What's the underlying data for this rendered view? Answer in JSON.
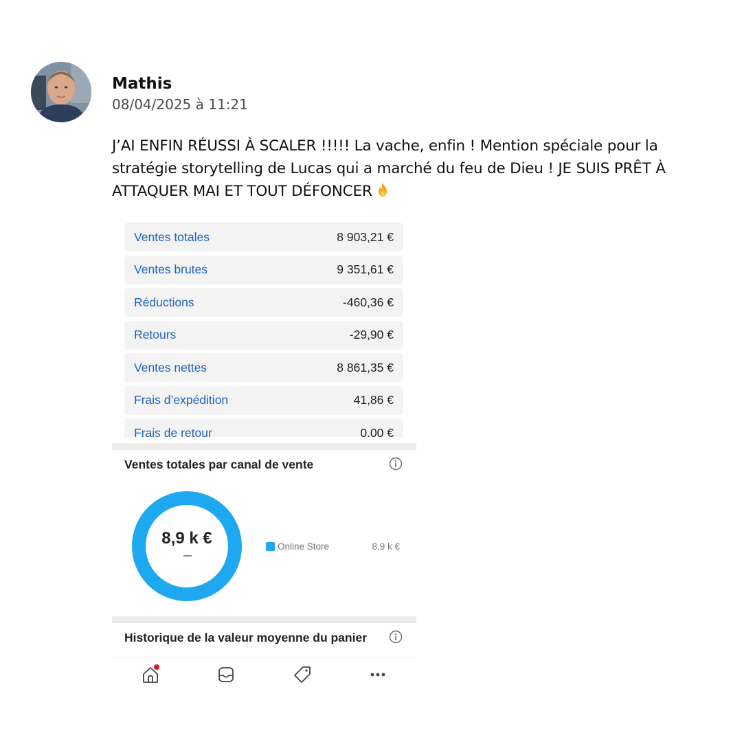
{
  "post": {
    "author": "Mathis",
    "date": "08/04/2025 à 11:21",
    "text": "J’AI ENFIN RÉUSSI À SCALER !!!!! La vache, enfin ! Mention spéciale pour la stratégie storytelling de Lucas qui a marché du feu de Dieu ! JE SUIS PRÊT À ATTAQUER MAI ET TOUT DÉFONCER",
    "emoji_icon": "fire-icon"
  },
  "metrics": [
    {
      "label": "Ventes totales",
      "value": "8 903,21 €"
    },
    {
      "label": "Ventes brutes",
      "value": "9 351,61 €"
    },
    {
      "label": "Réductions",
      "value": "-460,36 €"
    },
    {
      "label": "Retours",
      "value": "-29,90 €"
    },
    {
      "label": "Ventes nettes",
      "value": "8 861,35 €"
    },
    {
      "label": "Frais d’expédition",
      "value": "41,86 €"
    },
    {
      "label": "Frais de retour",
      "value": "0,00 €"
    }
  ],
  "channel_section": {
    "title": "Ventes totales par canal de vente",
    "total": "8,9 k €",
    "legend_label": "Online Store",
    "legend_value": "8,9 k €",
    "color": "#1ea8ef"
  },
  "history_section": {
    "title": "Historique de la valeur moyenne du panier"
  },
  "chart_data": {
    "type": "pie",
    "title": "Ventes totales par canal de vente",
    "categories": [
      "Online Store"
    ],
    "values": [
      8.9
    ],
    "unit": "k €",
    "colors": [
      "#1ea8ef"
    ]
  },
  "tabbar": {
    "items": [
      "home-icon",
      "inbox-icon",
      "tag-icon",
      "more-icon"
    ],
    "notification_color": "#e11d2b"
  }
}
